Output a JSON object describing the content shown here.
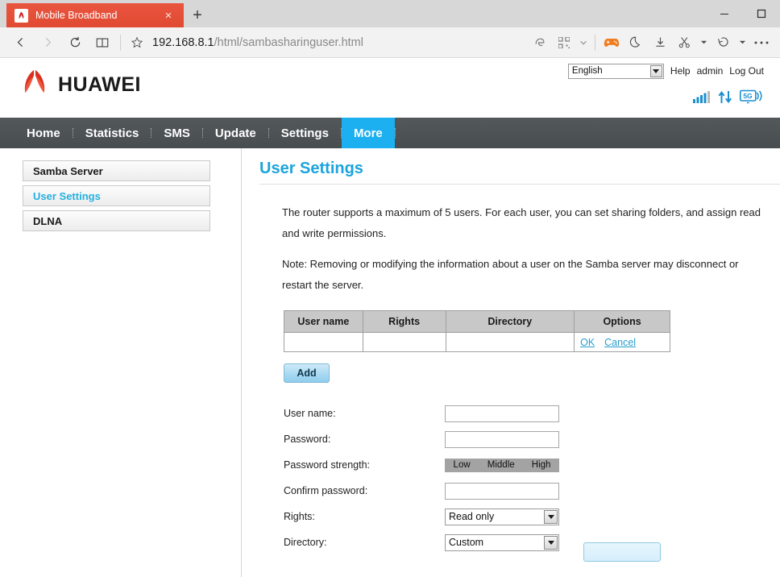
{
  "browser": {
    "tab": {
      "title": "Mobile Broadband",
      "favicon": "huawei-favicon",
      "close": "×"
    },
    "new_tab": "+",
    "window_controls": {
      "minimize": "minimize-icon",
      "maximize": "maximize-icon"
    },
    "nav": {
      "back": "back-arrow-icon",
      "forward": "forward-arrow-icon",
      "reload": "reload-icon",
      "reading_list": "book-icon",
      "favorite": "star-icon"
    },
    "address": {
      "host": "192.168.8.1",
      "path": "/html/sambasharinguser.html",
      "full": "192.168.8.1/html/sambasharinguser.html"
    },
    "toolbar_icons": [
      "edge-e-icon",
      "qr-code-icon",
      "chevron-down-icon",
      "game-controller-icon",
      "moon-icon",
      "download-icon",
      "scissors-icon",
      "scissors-caret-icon",
      "history-undo-icon",
      "history-caret-icon",
      "ellipsis-icon"
    ]
  },
  "header": {
    "brand": "HUAWEI",
    "language": {
      "value": "English",
      "options": [
        "English"
      ]
    },
    "links": {
      "help": "Help",
      "user": "admin",
      "logout": "Log Out"
    },
    "status_icons": [
      "signal-bars-icon",
      "data-updown-icon",
      "network-5g-icon"
    ],
    "network_label": "5G"
  },
  "mainnav": {
    "items": [
      {
        "label": "Home",
        "active": false
      },
      {
        "label": "Statistics",
        "active": false
      },
      {
        "label": "SMS",
        "active": false
      },
      {
        "label": "Update",
        "active": false
      },
      {
        "label": "Settings",
        "active": false
      },
      {
        "label": "More",
        "active": true
      }
    ]
  },
  "sidebar": {
    "items": [
      {
        "label": "Samba Server",
        "active": false
      },
      {
        "label": "User Settings",
        "active": true
      },
      {
        "label": "DLNA",
        "active": false
      }
    ]
  },
  "main": {
    "title": "User Settings",
    "paragraphs": [
      "The router supports a maximum of 5 users. For each user, you can set sharing folders, and assign read and write permissions.",
      "Note: Removing or modifying the information about a user on the Samba server may disconnect or restart the server."
    ],
    "table": {
      "headers": [
        "User name",
        "Rights",
        "Directory",
        "Options"
      ],
      "rows": [
        {
          "user_name": "",
          "rights": "",
          "directory": "",
          "options": {
            "ok": "OK",
            "cancel": "Cancel"
          }
        }
      ]
    },
    "add_button": "Add",
    "form": {
      "fields": [
        {
          "label": "User name:",
          "type": "text",
          "value": "",
          "placeholder": ""
        },
        {
          "label": "Password:",
          "type": "password",
          "value": "",
          "placeholder": ""
        },
        {
          "label": "Password strength:",
          "type": "strength",
          "levels": [
            "Low",
            "Middle",
            "High"
          ]
        },
        {
          "label": "Confirm password:",
          "type": "password",
          "value": "",
          "placeholder": ""
        },
        {
          "label": "Rights:",
          "type": "select",
          "value": "Read only",
          "options": [
            "Read only"
          ]
        },
        {
          "label": "Directory:",
          "type": "select",
          "value": "Custom",
          "options": [
            "Custom"
          ]
        }
      ]
    }
  },
  "colors": {
    "brand_red": "#e8503a",
    "accent_blue": "#1ba4dd",
    "nav_active": "#1cb0f0",
    "nav_bg": "#4e5356",
    "link": "#2a9fcc"
  }
}
